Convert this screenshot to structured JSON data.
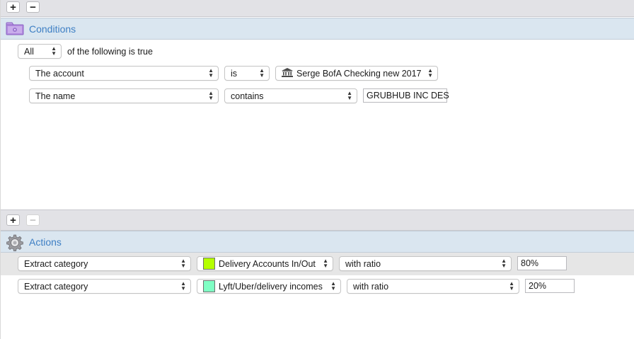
{
  "conditions": {
    "title": "Conditions",
    "toolbar": {
      "add": "+",
      "remove": "−"
    },
    "match": {
      "value": "All",
      "suffix": "of the following is true"
    },
    "rules": [
      {
        "field": "The account",
        "operator": "is",
        "value": "Serge BofA Checking new 2017",
        "value_icon": "bank-icon"
      },
      {
        "field": "The name",
        "operator": "contains",
        "value": "GRUBHUB INC DES"
      }
    ]
  },
  "actions": {
    "title": "Actions",
    "toolbar": {
      "add": "+",
      "remove": "−"
    },
    "rows": [
      {
        "action": "Extract category",
        "category": "Delivery Accounts In/Out",
        "color": "#b5ff00",
        "mode": "with ratio",
        "ratio": "80%"
      },
      {
        "action": "Extract category",
        "category": "Lyft/Uber/delivery incomes",
        "color": "#7fffc4",
        "mode": "with ratio",
        "ratio": "20%"
      }
    ]
  },
  "colors": {
    "accent": "#3e7fc4",
    "header_bg": "#dae6f0",
    "selected_row": "#e6e6e6"
  }
}
